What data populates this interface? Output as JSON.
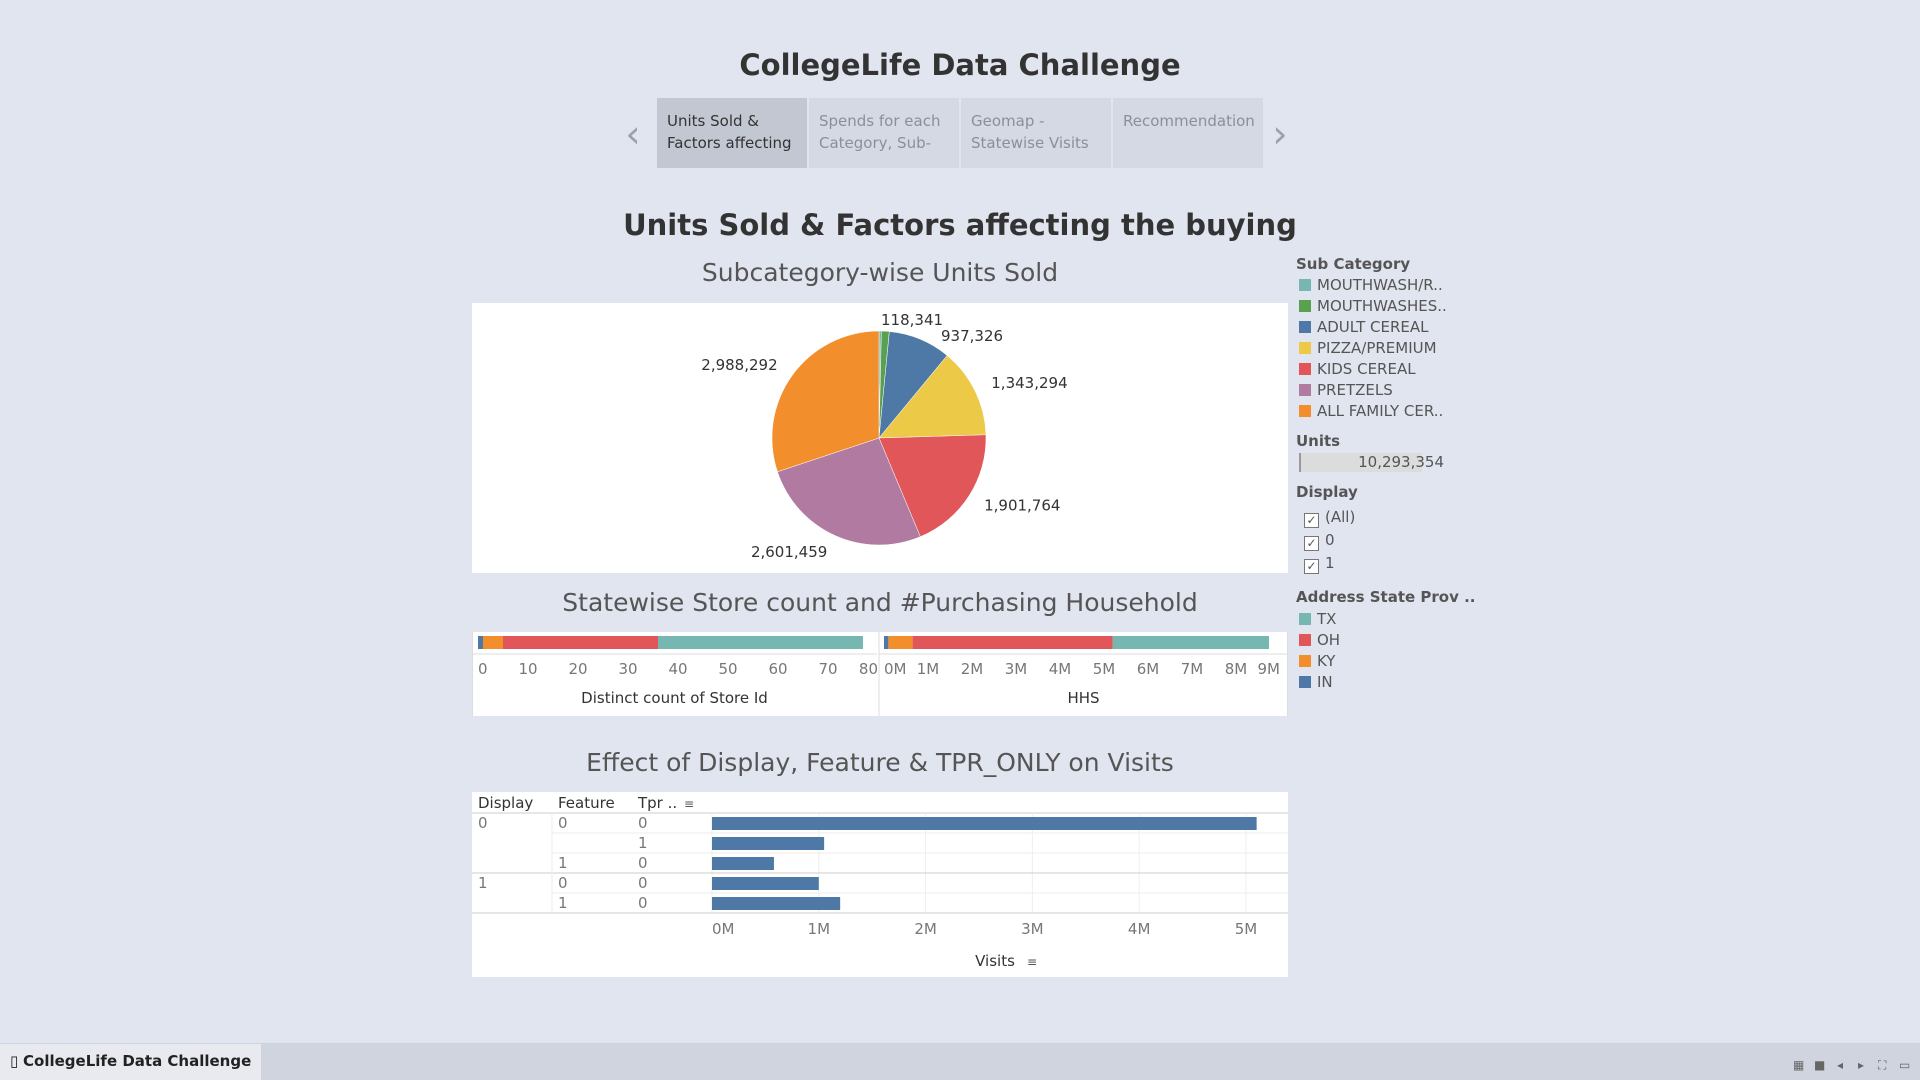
{
  "app_title": "CollegeLife Data Challenge",
  "story_tabs": [
    {
      "label_line1": "Units Sold &",
      "label_line2": "Factors affecting"
    },
    {
      "label_line1": "Spends for each",
      "label_line2": "Category, Sub-"
    },
    {
      "label_line1": "Geomap -",
      "label_line2": "Statewise Visits"
    },
    {
      "label_line1": "Recommendation",
      "label_line2": ""
    }
  ],
  "nav": {
    "prev": "‹",
    "next": "›"
  },
  "dashboard_title": "Units Sold & Factors affecting the buying",
  "sheets": {
    "pie_title": "Subcategory-wise Units Sold",
    "stacked_title": "Statewise Store count and #Purchasing Household",
    "visits_title": "Effect of Display, Feature & TPR_ONLY on Visits"
  },
  "legends": {
    "sub_category_title": "Sub Category",
    "sub_categories": [
      {
        "label": "MOUTHWASH/R..",
        "color": "#76b7b2"
      },
      {
        "label": "MOUTHWASHES..",
        "color": "#59a14f"
      },
      {
        "label": "ADULT CEREAL",
        "color": "#4e79a7"
      },
      {
        "label": "PIZZA/PREMIUM",
        "color": "#edc948"
      },
      {
        "label": "KIDS CEREAL",
        "color": "#e15759"
      },
      {
        "label": "PRETZELS",
        "color": "#b07aa1"
      },
      {
        "label": "ALL FAMILY CER..",
        "color": "#f28e2b"
      }
    ],
    "units_title": "Units",
    "units_value": "10,293,354",
    "display_title": "Display",
    "display_options": [
      "(All)",
      "0",
      "1"
    ],
    "checkmark": "✓",
    "state_title": "Address State Prov ..",
    "states": [
      {
        "label": "TX",
        "color": "#76b7b2"
      },
      {
        "label": "OH",
        "color": "#e15759"
      },
      {
        "label": "KY",
        "color": "#f28e2b"
      },
      {
        "label": "IN",
        "color": "#4e79a7"
      }
    ]
  },
  "chart_data": [
    {
      "type": "pie",
      "title": "Subcategory-wise Units Sold",
      "categories": [
        "MOUTHWASH/R..",
        "MOUTHWASHES..",
        "ADULT CEREAL",
        "PIZZA/PREMIUM",
        "KIDS CEREAL",
        "PRETZELS",
        "ALL FAMILY CER.."
      ],
      "values": [
        35000,
        118341,
        937326,
        1343294,
        1901764,
        2601459,
        2988292
      ],
      "labels": [
        "",
        "118,341",
        "937,326",
        "1,343,294",
        "1,901,764",
        "2,601,459",
        "2,988,292"
      ],
      "colors": [
        "#76b7b2",
        "#59a14f",
        "#4e79a7",
        "#edc948",
        "#e15759",
        "#b07aa1",
        "#f28e2b"
      ]
    },
    {
      "type": "bar",
      "title": "Statewise Store count and #Purchasing Household",
      "orientation": "horizontal-stacked",
      "panels": [
        {
          "xlabel": "Distinct count of Store Id",
          "xlim": [
            0,
            80
          ],
          "ticks": [
            "0",
            "10",
            "20",
            "30",
            "40",
            "50",
            "60",
            "70",
            "80"
          ],
          "series": [
            {
              "name": "IN",
              "value": 1
            },
            {
              "name": "KY",
              "value": 4
            },
            {
              "name": "OH",
              "value": 31
            },
            {
              "name": "TX",
              "value": 41
            }
          ]
        },
        {
          "xlabel": "HHS",
          "xlim": [
            0,
            9000000
          ],
          "ticks": [
            "0M",
            "1M",
            "2M",
            "3M",
            "4M",
            "5M",
            "6M",
            "7M",
            "8M",
            "9M"
          ],
          "series": [
            {
              "name": "IN",
              "value": 100000
            },
            {
              "name": "KY",
              "value": 550000
            },
            {
              "name": "OH",
              "value": 4550000
            },
            {
              "name": "TX",
              "value": 3550000
            }
          ]
        }
      ]
    },
    {
      "type": "bar",
      "title": "Effect of Display, Feature & TPR_ONLY on Visits",
      "orientation": "horizontal",
      "columns": [
        "Display",
        "Feature",
        "Tpr .."
      ],
      "rows": [
        {
          "display": "0",
          "feature": "0",
          "tpr": "0",
          "value": 5100000
        },
        {
          "display": "",
          "feature": "",
          "tpr": "1",
          "value": 1050000
        },
        {
          "display": "",
          "feature": "1",
          "tpr": "0",
          "value": 580000
        },
        {
          "display": "1",
          "feature": "0",
          "tpr": "0",
          "value": 1000000
        },
        {
          "display": "",
          "feature": "1",
          "tpr": "0",
          "value": 1200000
        }
      ],
      "xlabel": "Visits",
      "xlim": [
        0,
        5300000
      ],
      "ticks": [
        "0M",
        "1M",
        "2M",
        "3M",
        "4M",
        "5M"
      ],
      "bar_color": "#4e79a7"
    }
  ]
}
